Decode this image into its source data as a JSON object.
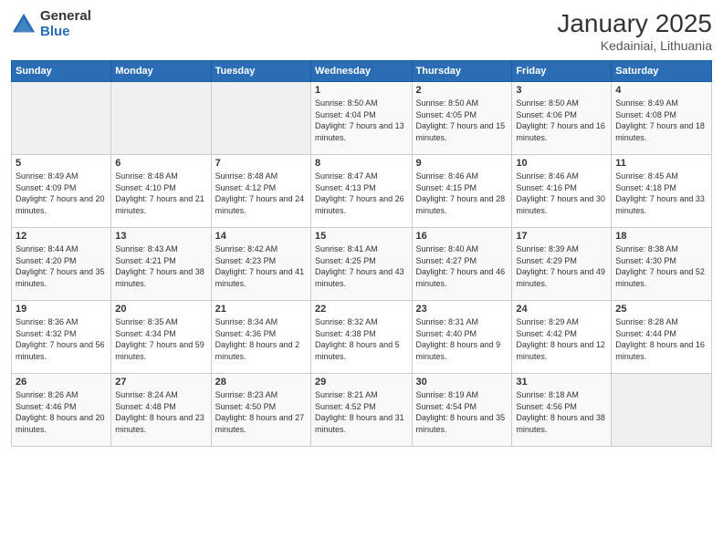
{
  "logo": {
    "general": "General",
    "blue": "Blue"
  },
  "title": "January 2025",
  "location": "Kedainiai, Lithuania",
  "weekdays": [
    "Sunday",
    "Monday",
    "Tuesday",
    "Wednesday",
    "Thursday",
    "Friday",
    "Saturday"
  ],
  "rows": [
    [
      {
        "day": "",
        "sunrise": "",
        "sunset": "",
        "daylight": ""
      },
      {
        "day": "",
        "sunrise": "",
        "sunset": "",
        "daylight": ""
      },
      {
        "day": "",
        "sunrise": "",
        "sunset": "",
        "daylight": ""
      },
      {
        "day": "1",
        "sunrise": "Sunrise: 8:50 AM",
        "sunset": "Sunset: 4:04 PM",
        "daylight": "Daylight: 7 hours and 13 minutes."
      },
      {
        "day": "2",
        "sunrise": "Sunrise: 8:50 AM",
        "sunset": "Sunset: 4:05 PM",
        "daylight": "Daylight: 7 hours and 15 minutes."
      },
      {
        "day": "3",
        "sunrise": "Sunrise: 8:50 AM",
        "sunset": "Sunset: 4:06 PM",
        "daylight": "Daylight: 7 hours and 16 minutes."
      },
      {
        "day": "4",
        "sunrise": "Sunrise: 8:49 AM",
        "sunset": "Sunset: 4:08 PM",
        "daylight": "Daylight: 7 hours and 18 minutes."
      }
    ],
    [
      {
        "day": "5",
        "sunrise": "Sunrise: 8:49 AM",
        "sunset": "Sunset: 4:09 PM",
        "daylight": "Daylight: 7 hours and 20 minutes."
      },
      {
        "day": "6",
        "sunrise": "Sunrise: 8:48 AM",
        "sunset": "Sunset: 4:10 PM",
        "daylight": "Daylight: 7 hours and 21 minutes."
      },
      {
        "day": "7",
        "sunrise": "Sunrise: 8:48 AM",
        "sunset": "Sunset: 4:12 PM",
        "daylight": "Daylight: 7 hours and 24 minutes."
      },
      {
        "day": "8",
        "sunrise": "Sunrise: 8:47 AM",
        "sunset": "Sunset: 4:13 PM",
        "daylight": "Daylight: 7 hours and 26 minutes."
      },
      {
        "day": "9",
        "sunrise": "Sunrise: 8:46 AM",
        "sunset": "Sunset: 4:15 PM",
        "daylight": "Daylight: 7 hours and 28 minutes."
      },
      {
        "day": "10",
        "sunrise": "Sunrise: 8:46 AM",
        "sunset": "Sunset: 4:16 PM",
        "daylight": "Daylight: 7 hours and 30 minutes."
      },
      {
        "day": "11",
        "sunrise": "Sunrise: 8:45 AM",
        "sunset": "Sunset: 4:18 PM",
        "daylight": "Daylight: 7 hours and 33 minutes."
      }
    ],
    [
      {
        "day": "12",
        "sunrise": "Sunrise: 8:44 AM",
        "sunset": "Sunset: 4:20 PM",
        "daylight": "Daylight: 7 hours and 35 minutes."
      },
      {
        "day": "13",
        "sunrise": "Sunrise: 8:43 AM",
        "sunset": "Sunset: 4:21 PM",
        "daylight": "Daylight: 7 hours and 38 minutes."
      },
      {
        "day": "14",
        "sunrise": "Sunrise: 8:42 AM",
        "sunset": "Sunset: 4:23 PM",
        "daylight": "Daylight: 7 hours and 41 minutes."
      },
      {
        "day": "15",
        "sunrise": "Sunrise: 8:41 AM",
        "sunset": "Sunset: 4:25 PM",
        "daylight": "Daylight: 7 hours and 43 minutes."
      },
      {
        "day": "16",
        "sunrise": "Sunrise: 8:40 AM",
        "sunset": "Sunset: 4:27 PM",
        "daylight": "Daylight: 7 hours and 46 minutes."
      },
      {
        "day": "17",
        "sunrise": "Sunrise: 8:39 AM",
        "sunset": "Sunset: 4:29 PM",
        "daylight": "Daylight: 7 hours and 49 minutes."
      },
      {
        "day": "18",
        "sunrise": "Sunrise: 8:38 AM",
        "sunset": "Sunset: 4:30 PM",
        "daylight": "Daylight: 7 hours and 52 minutes."
      }
    ],
    [
      {
        "day": "19",
        "sunrise": "Sunrise: 8:36 AM",
        "sunset": "Sunset: 4:32 PM",
        "daylight": "Daylight: 7 hours and 56 minutes."
      },
      {
        "day": "20",
        "sunrise": "Sunrise: 8:35 AM",
        "sunset": "Sunset: 4:34 PM",
        "daylight": "Daylight: 7 hours and 59 minutes."
      },
      {
        "day": "21",
        "sunrise": "Sunrise: 8:34 AM",
        "sunset": "Sunset: 4:36 PM",
        "daylight": "Daylight: 8 hours and 2 minutes."
      },
      {
        "day": "22",
        "sunrise": "Sunrise: 8:32 AM",
        "sunset": "Sunset: 4:38 PM",
        "daylight": "Daylight: 8 hours and 5 minutes."
      },
      {
        "day": "23",
        "sunrise": "Sunrise: 8:31 AM",
        "sunset": "Sunset: 4:40 PM",
        "daylight": "Daylight: 8 hours and 9 minutes."
      },
      {
        "day": "24",
        "sunrise": "Sunrise: 8:29 AM",
        "sunset": "Sunset: 4:42 PM",
        "daylight": "Daylight: 8 hours and 12 minutes."
      },
      {
        "day": "25",
        "sunrise": "Sunrise: 8:28 AM",
        "sunset": "Sunset: 4:44 PM",
        "daylight": "Daylight: 8 hours and 16 minutes."
      }
    ],
    [
      {
        "day": "26",
        "sunrise": "Sunrise: 8:26 AM",
        "sunset": "Sunset: 4:46 PM",
        "daylight": "Daylight: 8 hours and 20 minutes."
      },
      {
        "day": "27",
        "sunrise": "Sunrise: 8:24 AM",
        "sunset": "Sunset: 4:48 PM",
        "daylight": "Daylight: 8 hours and 23 minutes."
      },
      {
        "day": "28",
        "sunrise": "Sunrise: 8:23 AM",
        "sunset": "Sunset: 4:50 PM",
        "daylight": "Daylight: 8 hours and 27 minutes."
      },
      {
        "day": "29",
        "sunrise": "Sunrise: 8:21 AM",
        "sunset": "Sunset: 4:52 PM",
        "daylight": "Daylight: 8 hours and 31 minutes."
      },
      {
        "day": "30",
        "sunrise": "Sunrise: 8:19 AM",
        "sunset": "Sunset: 4:54 PM",
        "daylight": "Daylight: 8 hours and 35 minutes."
      },
      {
        "day": "31",
        "sunrise": "Sunrise: 8:18 AM",
        "sunset": "Sunset: 4:56 PM",
        "daylight": "Daylight: 8 hours and 38 minutes."
      },
      {
        "day": "",
        "sunrise": "",
        "sunset": "",
        "daylight": ""
      }
    ]
  ]
}
